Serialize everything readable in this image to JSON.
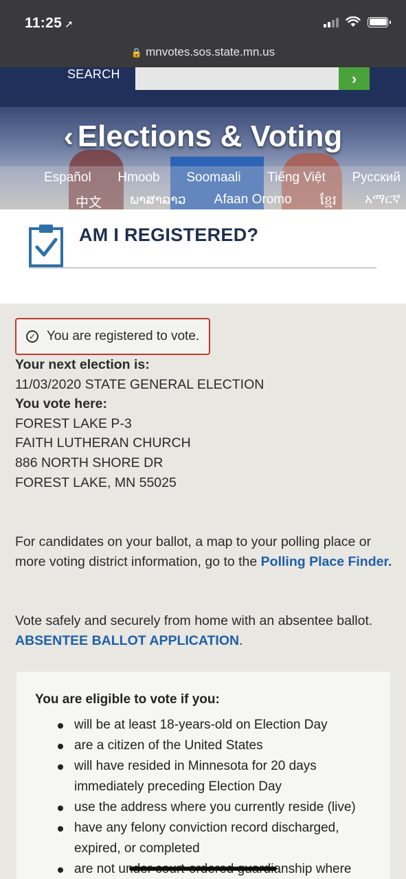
{
  "status": {
    "time": "11:25"
  },
  "browser": {
    "url": "mnvotes.sos.state.mn.us"
  },
  "header": {
    "search_label": "SEARCH",
    "search_button": "›",
    "title": "Elections & Voting",
    "languages_row1": [
      "Español",
      "Hmoob",
      "Soomaali",
      "Tiếng Việt",
      "Русский"
    ],
    "languages_row2": [
      "中文",
      "ພາສາລາວ",
      "Afaan Oromo",
      "ខ្មែរ",
      "አማርኛ"
    ]
  },
  "page": {
    "title": "AM I REGISTERED?"
  },
  "result": {
    "status_text": "You are registered to vote.",
    "next_election_label": "Your next election is:",
    "next_election_value": "11/03/2020 STATE GENERAL ELECTION",
    "vote_here_label": "You vote here:",
    "address_lines": [
      "FOREST LAKE P-3",
      "FAITH LUTHERAN CHURCH",
      "886 NORTH SHORE DR",
      "FOREST LAKE, MN 55025"
    ]
  },
  "info": {
    "ballot_text": "For candidates on your ballot, a map to your polling place or more voting district information, go to the ",
    "ballot_link": "Polling Place Finder.",
    "absentee_text": "Vote safely and securely from home with an absentee ballot.",
    "absentee_link": "ABSENTEE BALLOT APPLICATION",
    "absentee_tail": "."
  },
  "eligibility": {
    "heading": "You are eligible to vote if you:",
    "items": [
      "will be at least 18-years-old on Election Day",
      "are a citizen of the United States",
      "will have resided in Minnesota for 20 days immediately preceding Election Day",
      "use the address where you currently reside (live)",
      "have any felony conviction record discharged, expired, or completed",
      "are not under court-ordered guardianship where"
    ]
  },
  "colors": {
    "navy": "#1f2f5a",
    "link": "#1f5fa8",
    "alert_border": "#c0392b",
    "search_go": "#4aa23a"
  }
}
